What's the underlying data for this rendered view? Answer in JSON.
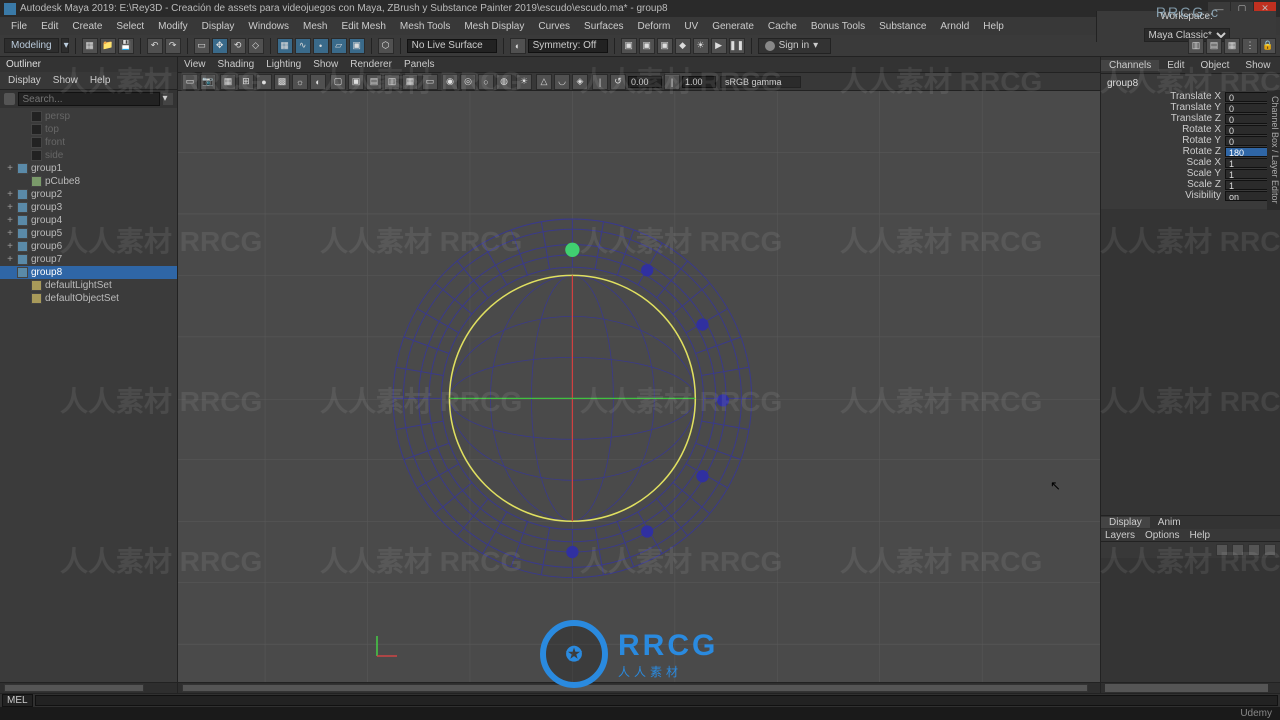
{
  "title": "Autodesk Maya 2019: E:\\Rey3D - Creación de assets para videojuegos con Maya, ZBrush y Substance Painter 2019\\escudo\\escudo.ma*  -  group8",
  "watermark_brand": "RRCG.c",
  "menu": [
    "File",
    "Edit",
    "Create",
    "Select",
    "Modify",
    "Display",
    "Windows",
    "Mesh",
    "Edit Mesh",
    "Mesh Tools",
    "Mesh Display",
    "Curves",
    "Surfaces",
    "Deform",
    "UV",
    "Generate",
    "Cache",
    "Bonus Tools",
    "Substance",
    "Arnold",
    "Help"
  ],
  "workspace_label": "Workspace:",
  "workspace_value": "Maya Classic*",
  "shelf": {
    "mode": "Modeling",
    "no_live": "No Live Surface",
    "symmetry": "Symmetry: Off",
    "signin": "Sign in"
  },
  "outliner": {
    "title": "Outliner",
    "menus": [
      "Display",
      "Show",
      "Help"
    ],
    "search_ph": "Search...",
    "items": [
      {
        "label": "persp",
        "icon": "cam",
        "dim": true,
        "depth": 1
      },
      {
        "label": "top",
        "icon": "cam",
        "dim": true,
        "depth": 1
      },
      {
        "label": "front",
        "icon": "cam",
        "dim": true,
        "depth": 1
      },
      {
        "label": "side",
        "icon": "cam",
        "dim": true,
        "depth": 1
      },
      {
        "label": "group1",
        "icon": "grp",
        "toggle": "+",
        "depth": 0,
        "exp": true
      },
      {
        "label": "pCube8",
        "icon": "mesh",
        "depth": 1
      },
      {
        "label": "group2",
        "icon": "grp",
        "toggle": "+",
        "depth": 0
      },
      {
        "label": "group3",
        "icon": "grp",
        "toggle": "+",
        "depth": 0
      },
      {
        "label": "group4",
        "icon": "grp",
        "toggle": "+",
        "depth": 0
      },
      {
        "label": "group5",
        "icon": "grp",
        "toggle": "+",
        "depth": 0
      },
      {
        "label": "group6",
        "icon": "grp",
        "toggle": "+",
        "depth": 0
      },
      {
        "label": "group7",
        "icon": "grp",
        "toggle": "+",
        "depth": 0
      },
      {
        "label": "group8",
        "icon": "grp",
        "depth": 0,
        "sel": true
      },
      {
        "label": "defaultLightSet",
        "icon": "light",
        "depth": 1
      },
      {
        "label": "defaultObjectSet",
        "icon": "light",
        "depth": 1
      }
    ]
  },
  "viewport": {
    "menus": [
      "View",
      "Shading",
      "Lighting",
      "Show",
      "Renderer",
      "Panels"
    ],
    "near": "0.00",
    "far": "1.00",
    "gamma": "sRGB gamma"
  },
  "channel": {
    "tabs": [
      "Channels",
      "Edit",
      "Object",
      "Show"
    ],
    "side": "Channel Box / Layer Editor",
    "node": "group8",
    "attrs": [
      {
        "label": "Translate X",
        "value": "0"
      },
      {
        "label": "Translate Y",
        "value": "0"
      },
      {
        "label": "Translate Z",
        "value": "0"
      },
      {
        "label": "Rotate X",
        "value": "0"
      },
      {
        "label": "Rotate Y",
        "value": "0"
      },
      {
        "label": "Rotate Z",
        "value": "180",
        "hl": true
      },
      {
        "label": "Scale X",
        "value": "1"
      },
      {
        "label": "Scale Y",
        "value": "1"
      },
      {
        "label": "Scale Z",
        "value": "1"
      },
      {
        "label": "Visibility",
        "value": "on"
      }
    ],
    "layer_tabs": [
      "Display",
      "Anim"
    ],
    "layer_menu": [
      "Layers",
      "Options",
      "Help"
    ]
  },
  "cmd": {
    "lang": "MEL"
  },
  "bottom_brand": "Udemy",
  "logo": {
    "main": "RRCG",
    "sub": "人人素材"
  },
  "wm_text": "人人素材 RRCG"
}
